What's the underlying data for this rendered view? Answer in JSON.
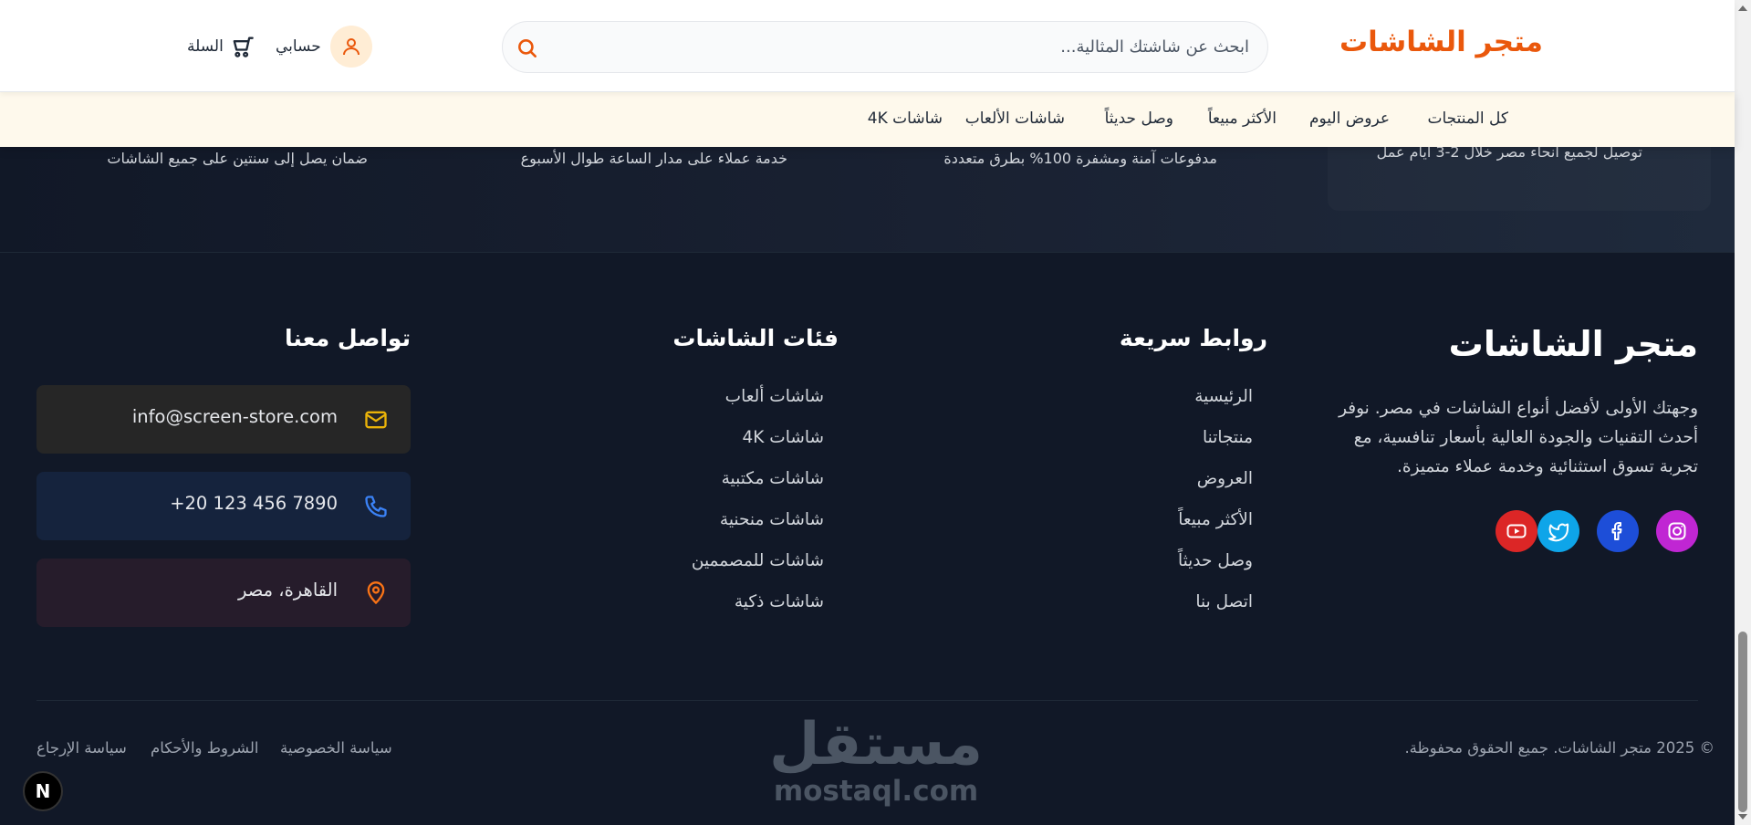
{
  "header": {
    "logo": "متجر الشاشات",
    "search_placeholder": "ابحث عن شاشتك المثالية...",
    "account_label": "حسابي",
    "cart_label": "السلة"
  },
  "category_nav": {
    "items": [
      "كل المنتجات",
      "عروض اليوم",
      "الأكثر مبيعاً",
      "وصل حديثاً",
      "شاشات الألعاب",
      "شاشات 4K"
    ]
  },
  "features": {
    "items": [
      "توصيل لجميع أنحاء مصر خلال 2-3 أيام عمل",
      "مدفوعات آمنة ومشفرة 100% بطرق متعددة",
      "خدمة عملاء على مدار الساعة طوال الأسبوع",
      "ضمان يصل إلى سنتين على جميع الشاشات"
    ]
  },
  "footer": {
    "brand": {
      "title": "متجر الشاشات",
      "description": "وجهتك الأولى لأفضل أنواع الشاشات في مصر. نوفر أحدث التقنيات والجودة العالية بأسعار تنافسية، مع تجربة تسوق استثنائية وخدمة عملاء متميزة."
    },
    "social": [
      {
        "name": "instagram-icon",
        "color": "#c026d3"
      },
      {
        "name": "facebook-icon",
        "color": "#1d4ed8"
      },
      {
        "name": "twitter-icon",
        "color": "#0ea5e9"
      },
      {
        "name": "youtube-icon",
        "color": "#dc2626"
      }
    ],
    "quick_links": {
      "title": "روابط سريعة",
      "items": [
        "الرئيسية",
        "منتجاتنا",
        "العروض",
        "الأكثر مبيعاً",
        "وصل حديثاً",
        "اتصل بنا"
      ]
    },
    "categories": {
      "title": "فئات الشاشات",
      "items": [
        "شاشات ألعاب",
        "شاشات 4K",
        "شاشات مكتبية",
        "شاشات منحنية",
        "شاشات للمصممين",
        "شاشات ذكية"
      ]
    },
    "contact": {
      "title": "تواصل معنا",
      "email": "info@screen-store.com",
      "phone": "+20 123 456 7890",
      "address": "القاهرة، مصر",
      "colors": {
        "email": "#eab308",
        "phone": "#3b82f6",
        "address": "#f97316"
      }
    },
    "bottom": {
      "copyright": "© 2025 متجر الشاشات. جميع الحقوق محفوظة.",
      "links": [
        "سياسة الخصوصية",
        "الشروط والأحكام",
        "سياسة الإرجاع"
      ]
    }
  },
  "watermark": {
    "arabic": "مستقل",
    "latin": "mostaql.com"
  },
  "dev_badge": "N"
}
